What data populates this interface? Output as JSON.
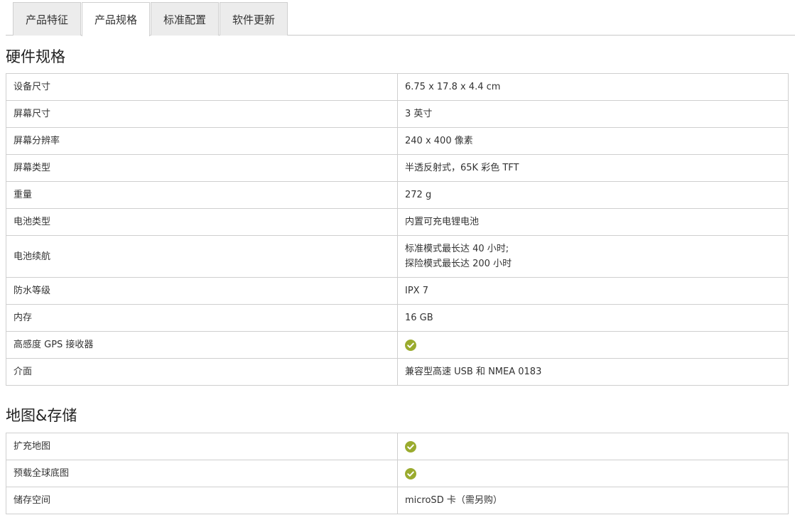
{
  "tabs": [
    {
      "label": "产品特征",
      "active": false
    },
    {
      "label": "产品规格",
      "active": true
    },
    {
      "label": "标准配置",
      "active": false
    },
    {
      "label": "软件更新",
      "active": false
    }
  ],
  "hardware": {
    "title": "硬件规格",
    "rows": [
      {
        "key": "设备尺寸",
        "value": "6.75 x 17.8 x 4.4 cm"
      },
      {
        "key": "屏幕尺寸",
        "value": "3 英寸"
      },
      {
        "key": "屏幕分辨率",
        "value": "240 x 400 像素"
      },
      {
        "key": "屏幕类型",
        "value": "半透反射式，65K 彩色 TFT"
      },
      {
        "key": "重量",
        "value": "272 g"
      },
      {
        "key": "电池类型",
        "value": "内置可充电锂电池"
      },
      {
        "key": "电池续航",
        "value_line1": "标准模式最长达 40 小时;",
        "value_line2": "探险模式最长达 200 小时"
      },
      {
        "key": "防水等级",
        "value": "IPX 7"
      },
      {
        "key": "内存",
        "value": "16 GB"
      },
      {
        "key": "高感度 GPS 接收器",
        "value_icon": "check-circle-icon"
      },
      {
        "key": "介面",
        "value": "兼容型高速 USB 和 NMEA 0183"
      }
    ]
  },
  "maps": {
    "title": "地图&存储",
    "rows": [
      {
        "key": "扩充地图",
        "value_icon": "check-circle-icon"
      },
      {
        "key": "预载全球底图",
        "value_icon": "check-circle-icon"
      },
      {
        "key": "储存空间",
        "value": "microSD 卡（需另购）"
      }
    ]
  },
  "colors": {
    "check": "#9aab2e",
    "border": "#cfcfcf",
    "tab_bg": "#ececec"
  }
}
